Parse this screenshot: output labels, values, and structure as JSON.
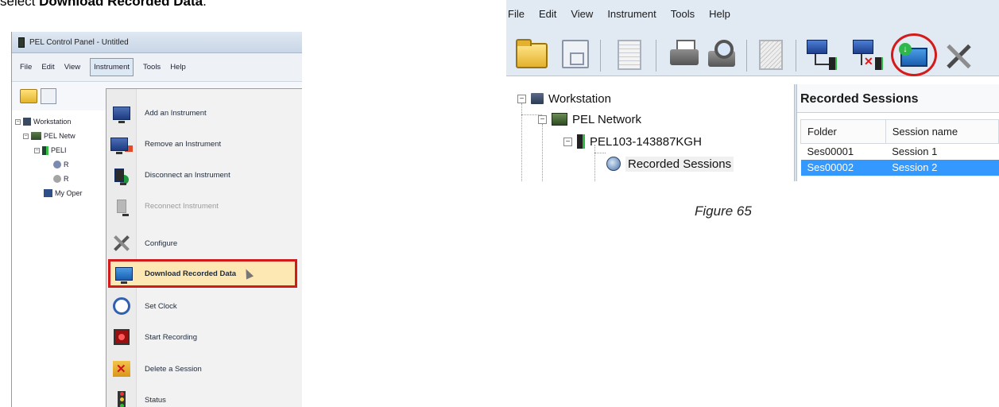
{
  "intro": {
    "prefix": "select ",
    "bold": "Download Recorded Data",
    "suffix": "."
  },
  "left": {
    "window_title": "PEL Control Panel - Untitled",
    "menu": [
      "File",
      "Edit",
      "View",
      "Instrument",
      "Tools",
      "Help"
    ],
    "tree": [
      "Workstation",
      "PEL Netw",
      "PELI",
      "R",
      "R",
      "My Oper"
    ],
    "dropdown": [
      {
        "label": "Add an Instrument",
        "icon": "add-instrument-icon"
      },
      {
        "label": "Remove an Instrument",
        "icon": "remove-instrument-icon"
      },
      {
        "label": "Disconnect an Instrument",
        "icon": "disconnect-instrument-icon"
      },
      {
        "label": "Reconnect Instrument",
        "icon": "reconnect-instrument-icon",
        "disabled": true
      },
      {
        "label": "Configure",
        "icon": "configure-icon"
      },
      {
        "label": "Download Recorded Data",
        "icon": "download-icon",
        "highlighted": true
      },
      {
        "label": "Set Clock",
        "icon": "clock-icon"
      },
      {
        "label": "Start Recording",
        "icon": "record-icon"
      },
      {
        "label": "Delete a Session",
        "icon": "delete-session-icon"
      },
      {
        "label": "Status",
        "icon": "status-icon"
      }
    ]
  },
  "right": {
    "menu": [
      "File",
      "Edit",
      "View",
      "Instrument",
      "Tools",
      "Help"
    ],
    "tree": {
      "workstation": "Workstation",
      "network": "PEL Network",
      "device": "PEL103-143887KGH",
      "sessions": "Recorded Sessions"
    },
    "panel": {
      "title": "Recorded Sessions",
      "columns": [
        "Folder",
        "Session name"
      ],
      "rows": [
        [
          "Ses00001",
          "Session 1"
        ],
        [
          "Ses00002",
          "Session 2"
        ]
      ]
    },
    "highlight_color": "#d41b1b",
    "selection_color": "#3399ff"
  },
  "figure_caption": "Figure 65"
}
